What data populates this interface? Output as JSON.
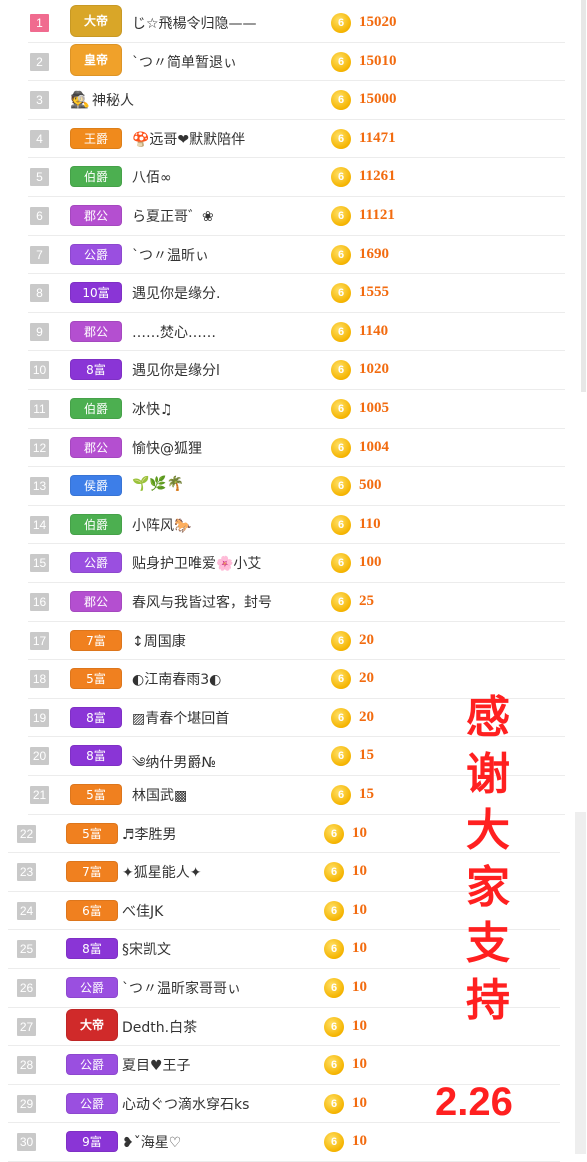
{
  "thanks": "感谢大家支持",
  "date": "2.26",
  "coin_glyph": "6",
  "colors": {
    "score": "#f26b0f",
    "thanks": "#ff2020",
    "rank_first": "#f06b8f",
    "rank_default": "#c9c9c9"
  },
  "rows": [
    {
      "rank": "1",
      "badge": "大帝",
      "badge_color": "#d9a628",
      "name": "じ☆飛楊令归隐——",
      "score": "15020"
    },
    {
      "rank": "2",
      "badge": "皇帝",
      "badge_color": "#f0a12a",
      "name": "ˋつ〃简单暂退ぃ",
      "score": "15010"
    },
    {
      "rank": "3",
      "badge": "",
      "badge_color": "",
      "hat": "🕵",
      "name": "神秘人",
      "score": "15000"
    },
    {
      "rank": "4",
      "badge": "王爵",
      "badge_color": "#f08a1c",
      "name": "🍄远哥❤默默陪伴",
      "score": "11471"
    },
    {
      "rank": "5",
      "badge": "伯爵",
      "badge_color": "#4caf50",
      "name": "八佰∞",
      "score": "11261"
    },
    {
      "rank": "6",
      "badge": "郡公",
      "badge_color": "#b44fd0",
      "name": "ら夏正哥゛❀",
      "score": "11121"
    },
    {
      "rank": "7",
      "badge": "公爵",
      "badge_color": "#9a4fe0",
      "name": "ˋつ〃温昕ぃ",
      "score": "1690"
    },
    {
      "rank": "8",
      "badge": "10富",
      "badge_color": "#8a35d6",
      "name": "遇见你是缘分.",
      "score": "1555"
    },
    {
      "rank": "9",
      "badge": "郡公",
      "badge_color": "#b44fd0",
      "name": "……焚心……",
      "score": "1140"
    },
    {
      "rank": "10",
      "badge": "8富",
      "badge_color": "#8a35d6",
      "name": "遇见你是缘分l",
      "score": "1020"
    },
    {
      "rank": "11",
      "badge": "伯爵",
      "badge_color": "#4caf50",
      "name": "冰快♫",
      "score": "1005"
    },
    {
      "rank": "12",
      "badge": "郡公",
      "badge_color": "#b44fd0",
      "name": "愉快@狐狸",
      "score": "1004"
    },
    {
      "rank": "13",
      "badge": "侯爵",
      "badge_color": "#3d7ee8",
      "name": "🌱🌿🌴",
      "score": "500"
    },
    {
      "rank": "14",
      "badge": "伯爵",
      "badge_color": "#4caf50",
      "name": "小阵风🐎",
      "score": "110"
    },
    {
      "rank": "15",
      "badge": "公爵",
      "badge_color": "#9a4fe0",
      "name": "贴身护卫唯爱🌸小艾",
      "score": "100"
    },
    {
      "rank": "16",
      "badge": "郡公",
      "badge_color": "#b44fd0",
      "name": "春风与我皆过客，封号",
      "score": "25"
    },
    {
      "rank": "17",
      "badge": "7富",
      "badge_color": "#f0801f",
      "name": "↕周国康",
      "score": "20"
    },
    {
      "rank": "18",
      "badge": "5富",
      "badge_color": "#f0801f",
      "name": "◐江南春雨3◐",
      "score": "20"
    },
    {
      "rank": "19",
      "badge": "8富",
      "badge_color": "#8a35d6",
      "name": "▨青春个堪回首",
      "score": "20"
    },
    {
      "rank": "20",
      "badge": "8富",
      "badge_color": "#8a35d6",
      "name": "༄纳什男爵№",
      "score": "15"
    },
    {
      "rank": "21",
      "badge": "5富",
      "badge_color": "#f0801f",
      "name": "林国武▩",
      "score": "15"
    },
    {
      "rank": "22",
      "badge": "5富",
      "badge_color": "#f0801f",
      "name": "♬李胜男",
      "score": "10"
    },
    {
      "rank": "23",
      "badge": "7富",
      "badge_color": "#f0801f",
      "name": "✦狐星能人✦",
      "score": "10"
    },
    {
      "rank": "24",
      "badge": "6富",
      "badge_color": "#f0801f",
      "name": "べ佳JK",
      "score": "10"
    },
    {
      "rank": "25",
      "badge": "8富",
      "badge_color": "#8a35d6",
      "name": "§宋凯文",
      "score": "10"
    },
    {
      "rank": "26",
      "badge": "公爵",
      "badge_color": "#9a4fe0",
      "name": "ˋつ〃温昕家哥哥ぃ",
      "score": "10"
    },
    {
      "rank": "27",
      "badge": "大帝",
      "badge_color": "#d02a2a",
      "name": "Dedth.白茶",
      "score": "10"
    },
    {
      "rank": "28",
      "badge": "公爵",
      "badge_color": "#9a4fe0",
      "name": "夏目♥王子",
      "score": "10"
    },
    {
      "rank": "29",
      "badge": "公爵",
      "badge_color": "#9a4fe0",
      "name": "心动ぐつ滴水穿石ks",
      "score": "10"
    },
    {
      "rank": "30",
      "badge": "9富",
      "badge_color": "#8a35d6",
      "name": "❥ˇ海星♡",
      "score": "10"
    }
  ]
}
